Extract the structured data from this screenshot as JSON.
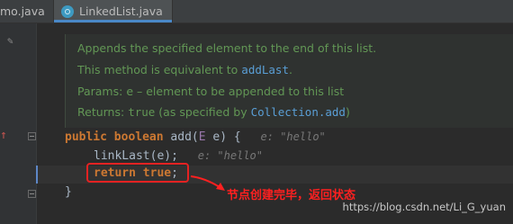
{
  "tabs": [
    {
      "label": "mo.java"
    },
    {
      "label": "LinkedList.java"
    }
  ],
  "doc": {
    "line1": "Appends the specified element to the end of this list.",
    "line2_prefix": "This method is equivalent to ",
    "line2_code": "addLast",
    "line2_suffix": ".",
    "params_label": "Params:",
    "params_text": "e – element to be appended to this list",
    "returns_label": "Returns:",
    "returns_code": "true",
    "returns_mid": "(as specified by ",
    "returns_link": "Collection.add",
    "returns_end": ")"
  },
  "code": {
    "l1_kw1": "public",
    "l1_kw2": "boolean",
    "l1_name": "add(",
    "l1_type": "E",
    "l1_rest": " e) {",
    "l1_hint": "e: \"hello\"",
    "l2_call": "linkLast(e);",
    "l2_hint": "e: \"hello\"",
    "l3_kw": "return",
    "l3_val": "true",
    "l3_end": ";",
    "l4": "}"
  },
  "annotation": {
    "text": "节点创建完毕，返回状态",
    "color": "#ff2020"
  },
  "watermark": "https://blog.csdn.net/Li_G_yuan",
  "colors": {
    "keyword": "#cc7832",
    "doc_text": "#629755",
    "doc_code": "#5a9fd6",
    "hint": "#787878",
    "type_param": "#9876aa"
  }
}
